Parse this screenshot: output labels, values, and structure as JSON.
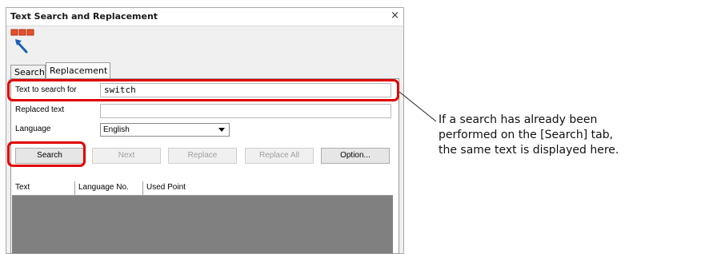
{
  "window": {
    "title": "Text Search and Replacement",
    "close_glyph": "×"
  },
  "tabs": [
    {
      "label": "Search",
      "active": false
    },
    {
      "label": "Replacement",
      "active": true
    }
  ],
  "form": {
    "search_label": "Text to search for",
    "search_value": "switch",
    "replaced_label": "Replaced text",
    "replaced_value": "",
    "language_label": "Language",
    "language_value": "English"
  },
  "buttons": {
    "search": "Search",
    "next": "Next",
    "replace": "Replace",
    "replace_all": "Replace All",
    "option": "Option..."
  },
  "list": {
    "columns": [
      "Text",
      "Language No.",
      "Used Point"
    ]
  },
  "callout": {
    "lines": [
      "If a search has already been",
      "performed on the [Search] tab,",
      "the same text is displayed here."
    ]
  },
  "colors": {
    "highlight": "#e00000",
    "list_bg": "#808080",
    "icon_red": "#e8502a",
    "icon_blue": "#1e5fb4"
  }
}
